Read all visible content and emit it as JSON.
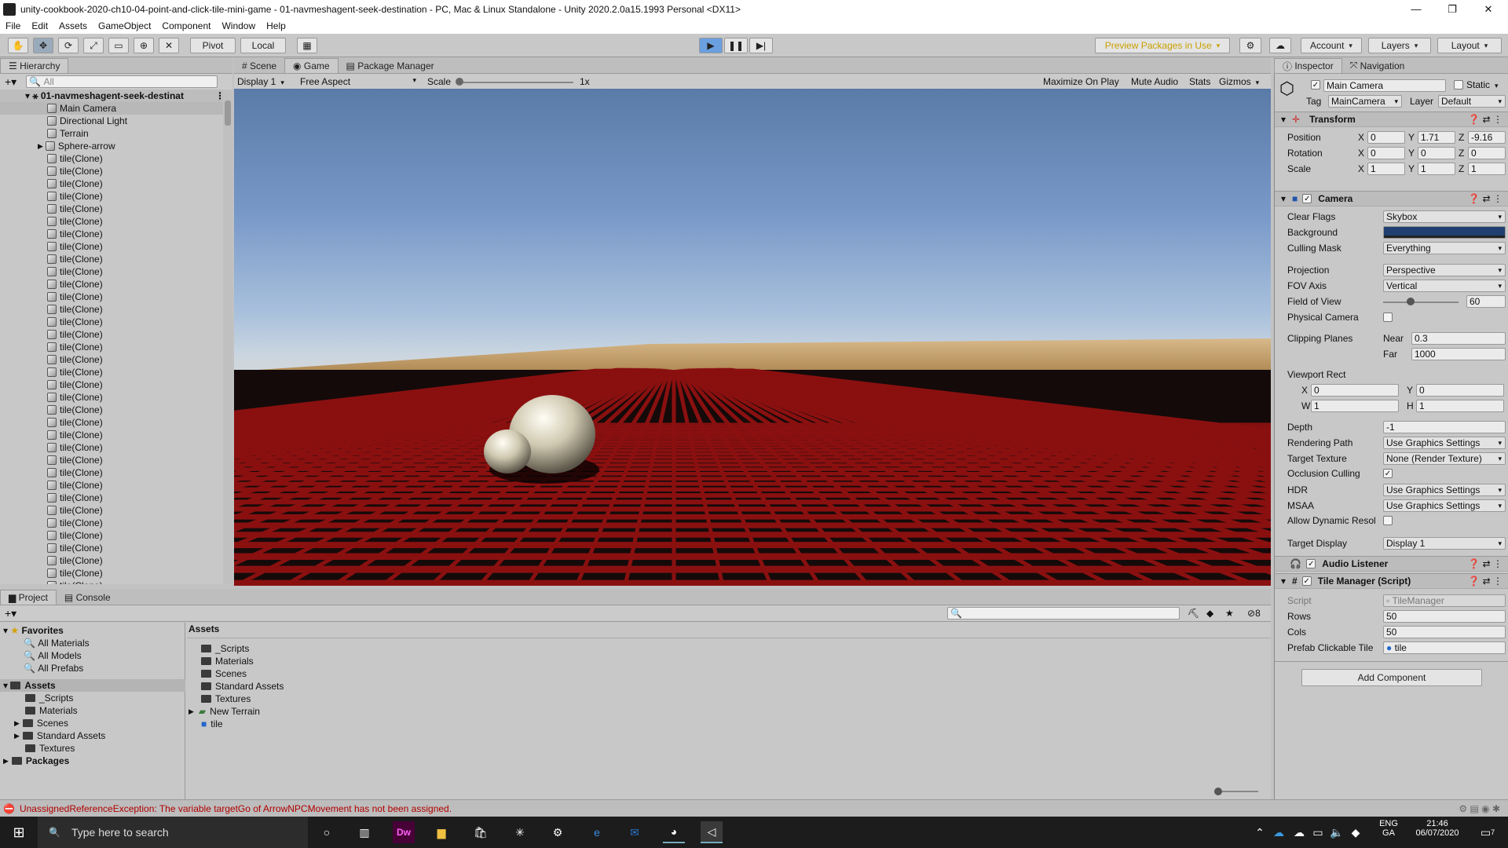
{
  "window": {
    "title": "unity-cookbook-2020-ch10-04-point-and-click-tile-mini-game - 01-navmeshagent-seek-destination - PC, Mac & Linux Standalone - Unity 2020.2.0a15.1993 Personal <DX11>"
  },
  "menu": [
    "File",
    "Edit",
    "Assets",
    "GameObject",
    "Component",
    "Window",
    "Help"
  ],
  "toolbar": {
    "pivot": "Pivot",
    "local": "Local",
    "preview_packages": "Preview Packages in Use",
    "account": "Account",
    "layers": "Layers",
    "layout": "Layout"
  },
  "hierarchy": {
    "tab": "Hierarchy",
    "search_placeholder": "All",
    "scene_name": "01-navmeshagent-seek-destinat",
    "items": [
      "Main Camera",
      "Directional Light",
      "Terrain",
      "Sphere-arrow"
    ],
    "tile_label": "tile(Clone)"
  },
  "center_tabs": [
    "Scene",
    "Game",
    "Package Manager"
  ],
  "game_bar": {
    "display": "Display 1",
    "aspect": "Free Aspect",
    "scale_label": "Scale",
    "scale_value": "1x",
    "maximize": "Maximize On Play",
    "mute": "Mute Audio",
    "stats": "Stats",
    "gizmos": "Gizmos"
  },
  "inspector": {
    "tabs": [
      "Inspector",
      "Navigation"
    ],
    "object_name": "Main Camera",
    "static_label": "Static",
    "tag_label": "Tag",
    "tag_value": "MainCamera",
    "layer_label": "Layer",
    "layer_value": "Default",
    "transform": {
      "title": "Transform",
      "position_label": "Position",
      "rotation_label": "Rotation",
      "scale_label": "Scale",
      "position": [
        "0",
        "1.71",
        "-9.16"
      ],
      "rotation": [
        "0",
        "0",
        "0"
      ],
      "scale": [
        "1",
        "1",
        "1"
      ]
    },
    "camera": {
      "title": "Camera",
      "fields": [
        {
          "label": "Clear Flags",
          "value": "Skybox"
        },
        {
          "label": "Background",
          "value": ""
        },
        {
          "label": "Culling Mask",
          "value": "Everything"
        },
        {
          "label": "Projection",
          "value": "Perspective"
        },
        {
          "label": "FOV Axis",
          "value": "Vertical"
        },
        {
          "label": "Field of View",
          "value": "60"
        },
        {
          "label": "Physical Camera",
          "value": ""
        }
      ],
      "clipping_label": "Clipping Planes",
      "near_label": "Near",
      "near": "0.3",
      "far_label": "Far",
      "far": "1000",
      "viewport_label": "Viewport Rect",
      "viewport": {
        "x": "0",
        "y": "0",
        "w": "1",
        "h": "1"
      },
      "fields2": [
        {
          "label": "Depth",
          "value": "-1"
        },
        {
          "label": "Rendering Path",
          "value": "Use Graphics Settings"
        },
        {
          "label": "Target Texture",
          "value": "None (Render Texture)"
        },
        {
          "label": "Occlusion Culling",
          "value": ""
        },
        {
          "label": "HDR",
          "value": "Use Graphics Settings"
        },
        {
          "label": "MSAA",
          "value": "Use Graphics Settings"
        },
        {
          "label": "Allow Dynamic Resol",
          "value": ""
        },
        {
          "label": "Target Display",
          "value": "Display 1"
        }
      ]
    },
    "audio_listener": "Audio Listener",
    "tile_manager": {
      "title": "Tile Manager (Script)",
      "script_label": "Script",
      "script_value": "TileManager",
      "rows_label": "Rows",
      "rows": "50",
      "cols_label": "Cols",
      "cols": "50",
      "prefab_label": "Prefab Clickable Tile",
      "prefab_value": "tile"
    },
    "add_component": "Add Component"
  },
  "project": {
    "tabs": [
      "Project",
      "Console"
    ],
    "favorites_label": "Favorites",
    "favorites": [
      "All Materials",
      "All Models",
      "All Prefabs"
    ],
    "assets_label": "Assets",
    "asset_folders": [
      "_Scripts",
      "Materials",
      "Scenes",
      "Standard Assets",
      "Textures"
    ],
    "packages_label": "Packages",
    "breadcrumb": "Assets",
    "contents": [
      "_Scripts",
      "Materials",
      "Scenes",
      "Standard Assets",
      "Textures",
      "New Terrain",
      "tile"
    ],
    "hidden_count": "8"
  },
  "status": {
    "message": "UnassignedReferenceException: The variable targetGo of ArrowNPCMovement has not been assigned."
  },
  "taskbar": {
    "search_placeholder": "Type here to search",
    "lang": "ENG",
    "lang_sub": "GA",
    "time": "21:46",
    "date": "06/07/2020",
    "notifications": "7"
  }
}
